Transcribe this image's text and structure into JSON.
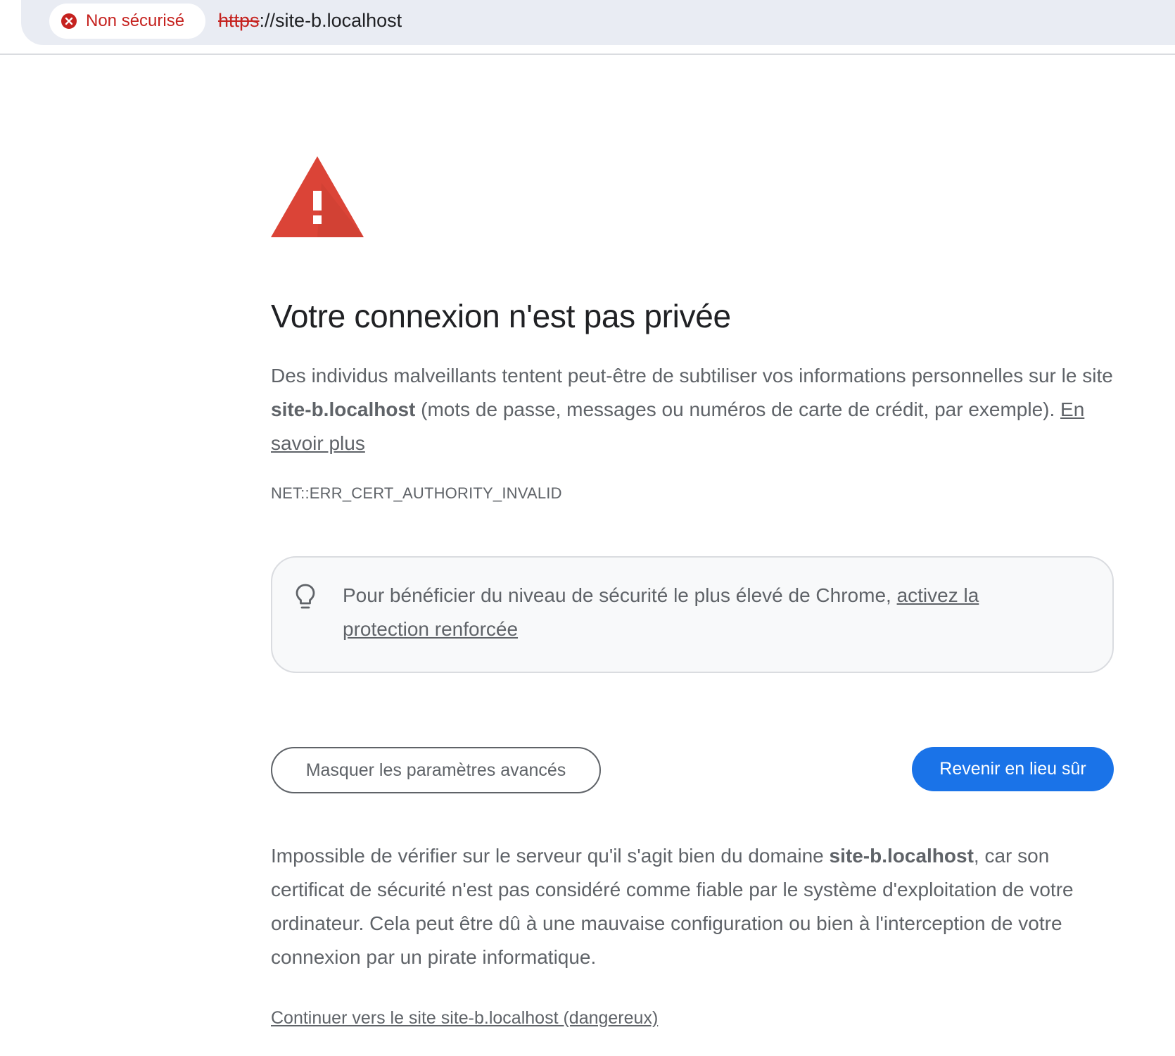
{
  "address_bar": {
    "security_chip_label": "Non sécurisé",
    "url_scheme": "https",
    "url_rest": "://site-b.localhost"
  },
  "interstitial": {
    "heading": "Votre connexion n'est pas privée",
    "main_message": {
      "part1": "Des individus malveillants tentent peut-être de subtiliser vos informations personnelles sur le site ",
      "domain": "site-b.localhost",
      "part2": " (mots de passe, messages ou numéros de carte de crédit, par exemple). ",
      "learn_more": "En savoir plus"
    },
    "error_code": "NET::ERR_CERT_AUTHORITY_INVALID",
    "callout": {
      "text": "Pour bénéficier du niveau de sécurité le plus élevé de Chrome, ",
      "link": "activez la protection renforcée"
    },
    "buttons": {
      "advanced": "Masquer les paramètres avancés",
      "back_to_safety": "Revenir en lieu sûr"
    },
    "details": {
      "part1": "Impossible de vérifier sur le serveur qu'il s'agit bien du domaine ",
      "domain": "site-b.localhost",
      "part2": ", car son certificat de sécurité n'est pas considéré comme fiable par le système d'exploitation de votre ordinateur. Cela peut être dû à une mauvaise configuration ou bien à l'interception de votre connexion par un pirate informatique."
    },
    "proceed_link": "Continuer vers le site site-b.localhost (dangereux)"
  },
  "colors": {
    "danger_red": "#c5221f",
    "warning_triangle": "#db4437",
    "primary_blue": "#1a73e8",
    "text_grey": "#5f6368",
    "heading_text": "#202124",
    "omnibox_bg": "#e9ecf3"
  },
  "icons": {
    "security_chip": "error-x-circle-icon",
    "warning": "warning-triangle-icon",
    "callout": "lightbulb-icon"
  }
}
